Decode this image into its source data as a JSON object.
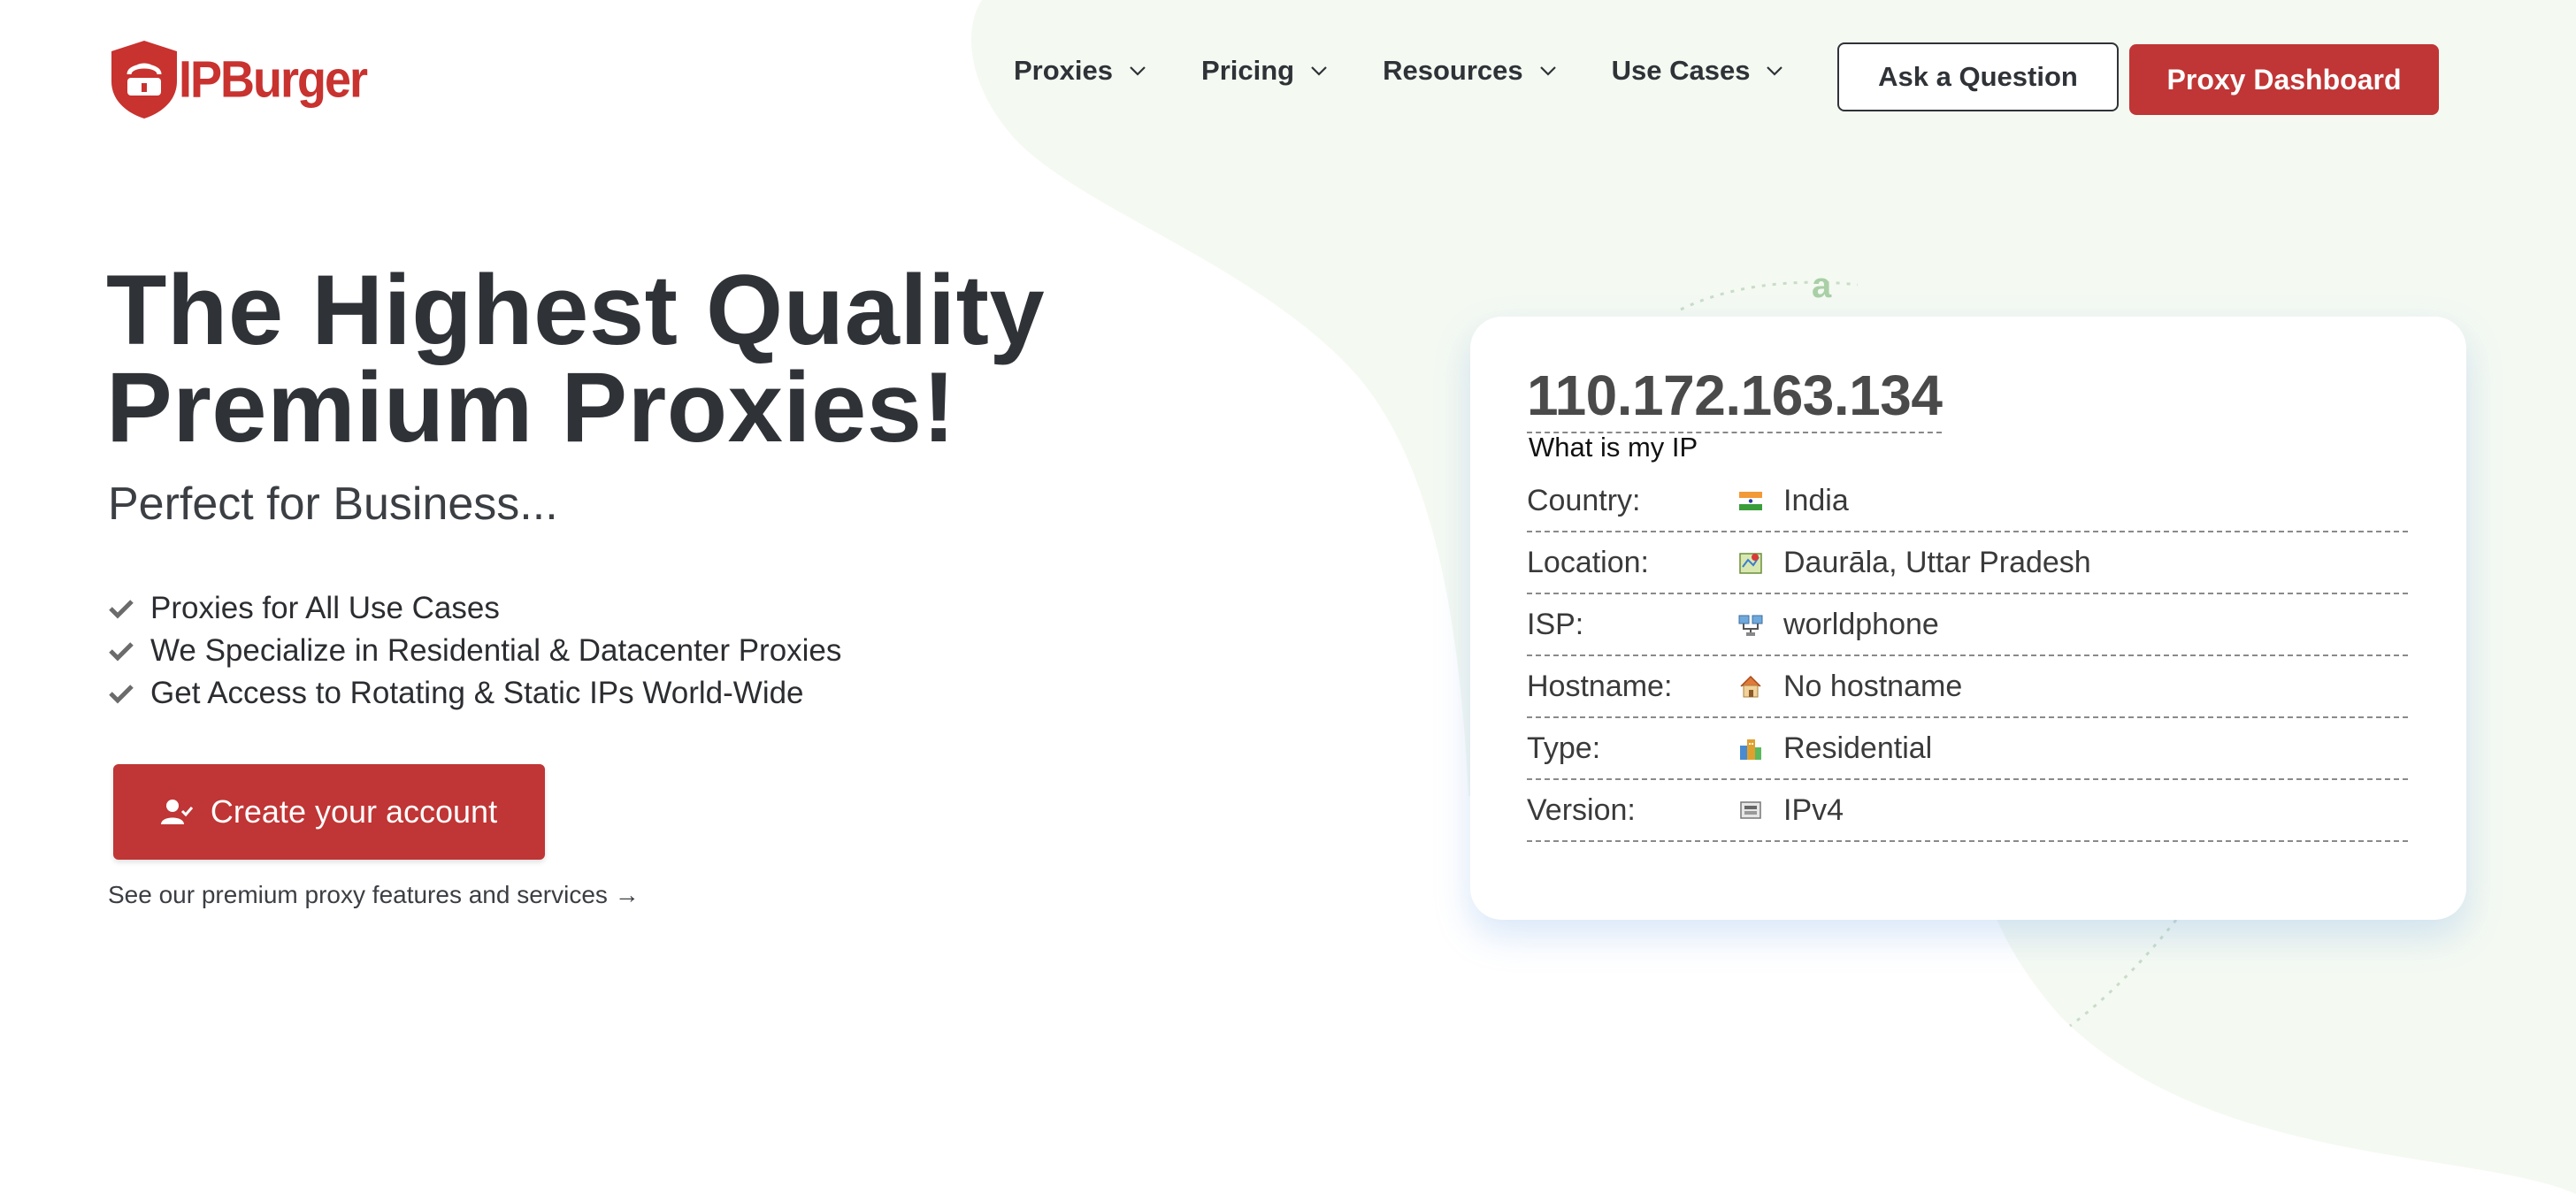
{
  "logo": {
    "text": "IPBurger"
  },
  "nav": {
    "items": [
      {
        "label": "Proxies"
      },
      {
        "label": "Pricing"
      },
      {
        "label": "Resources"
      },
      {
        "label": "Use Cases"
      }
    ],
    "ask_label": "Ask a Question",
    "dashboard_label": "Proxy Dashboard"
  },
  "hero": {
    "title_line1": "The Highest Quality",
    "title_line2": "Premium Proxies!",
    "subtitle": "Perfect for Business...",
    "features": [
      "Proxies for All Use Cases",
      "We Specialize in Residential & Datacenter Proxies",
      "Get Access to Rotating & Static IPs World-Wide"
    ],
    "cta_label": "Create your account",
    "see_more": "See our premium proxy features and services →"
  },
  "ip_card": {
    "ip": "110.172.163.134",
    "caption": "What is my IP",
    "rows": [
      {
        "label": "Country:",
        "value": "India",
        "icon": "india-flag-icon"
      },
      {
        "label": "Location:",
        "value": "Daurāla, Uttar Pradesh",
        "icon": "map-icon"
      },
      {
        "label": "ISP:",
        "value": "worldphone",
        "icon": "network-icon"
      },
      {
        "label": "Hostname:",
        "value": "No hostname",
        "icon": "house-icon"
      },
      {
        "label": "Type:",
        "value": "Residential",
        "icon": "buildings-icon"
      },
      {
        "label": "Version:",
        "value": "IPv4",
        "icon": "ip-chip-icon"
      }
    ]
  },
  "colors": {
    "brand_red": "#c03535",
    "text_dark": "#2f3237",
    "blob_green": "#f4f9f2"
  }
}
